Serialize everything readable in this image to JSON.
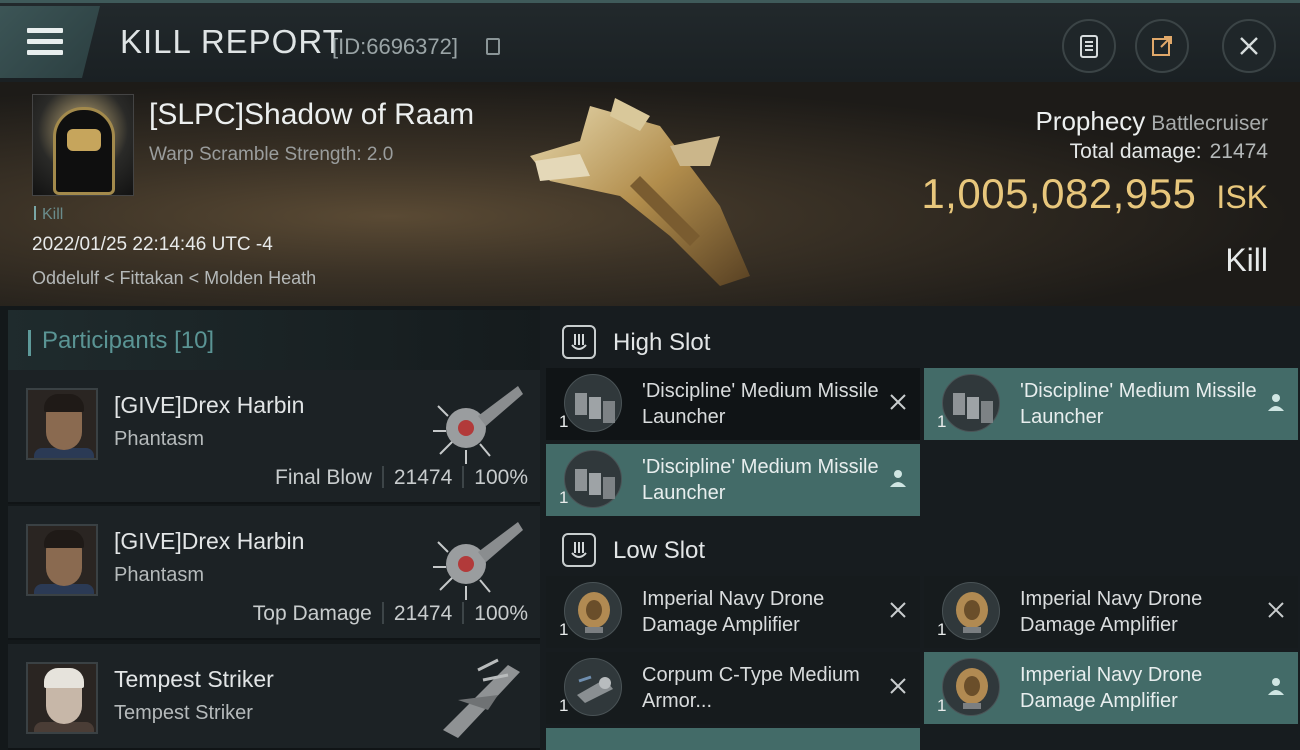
{
  "header": {
    "title": "KILL REPORT",
    "report_id": "[ID:6696372]",
    "buttons": [
      "clipboard-icon",
      "share-icon",
      "close-icon"
    ]
  },
  "victim": {
    "pilot": "[SLPC]Shadow of Raam",
    "warp_scramble": "Warp Scramble Strength: 2.0",
    "kill_tag": "Kill",
    "datetime": "2022/01/25 22:14:46 UTC -4",
    "location": "Oddelulf < Fittakan < Molden Heath",
    "ship_name": "Prophecy",
    "ship_class": "Battlecruiser",
    "total_damage_label": "Total damage:",
    "total_damage": "21474",
    "isk_value": "1,005,082,955",
    "isk_unit": "ISK",
    "result": "Kill"
  },
  "participants": {
    "title": "Participants",
    "count": "[10]",
    "list": [
      {
        "name": "[GIVE]Drex Harbin",
        "ship": "Phantasm",
        "role": "Final Blow",
        "damage": "21474",
        "percent": "100%"
      },
      {
        "name": "[GIVE]Drex Harbin",
        "ship": "Phantasm",
        "role": "Top Damage",
        "damage": "21474",
        "percent": "100%"
      },
      {
        "name": "Tempest Striker",
        "ship": "Tempest Striker",
        "role": "",
        "damage": "",
        "percent": ""
      }
    ]
  },
  "high_slot": {
    "title": "High Slot",
    "modules": [
      {
        "qty": "1",
        "name": "'Discipline' Medium Missile Launcher",
        "status": "destroyed"
      },
      {
        "qty": "1",
        "name": "'Discipline' Medium Missile Launcher",
        "status": "dropped"
      },
      {
        "qty": "1",
        "name": "'Discipline' Medium Missile Launcher",
        "status": "dropped"
      }
    ]
  },
  "low_slot": {
    "title": "Low Slot",
    "modules": [
      {
        "qty": "1",
        "name": "Imperial Navy Drone Damage Amplifier",
        "status": "destroyed"
      },
      {
        "qty": "1",
        "name": "Imperial Navy Drone Damage Amplifier",
        "status": "destroyed"
      },
      {
        "qty": "1",
        "name": "Corpum C-Type Medium Armor...",
        "status": "destroyed"
      },
      {
        "qty": "1",
        "name": "Imperial Navy Drone Damage Amplifier",
        "status": "dropped"
      }
    ]
  },
  "colors": {
    "accent_teal": "#436b68",
    "isk_gold": "#e8c77c",
    "participants_teal": "#5a9494"
  }
}
